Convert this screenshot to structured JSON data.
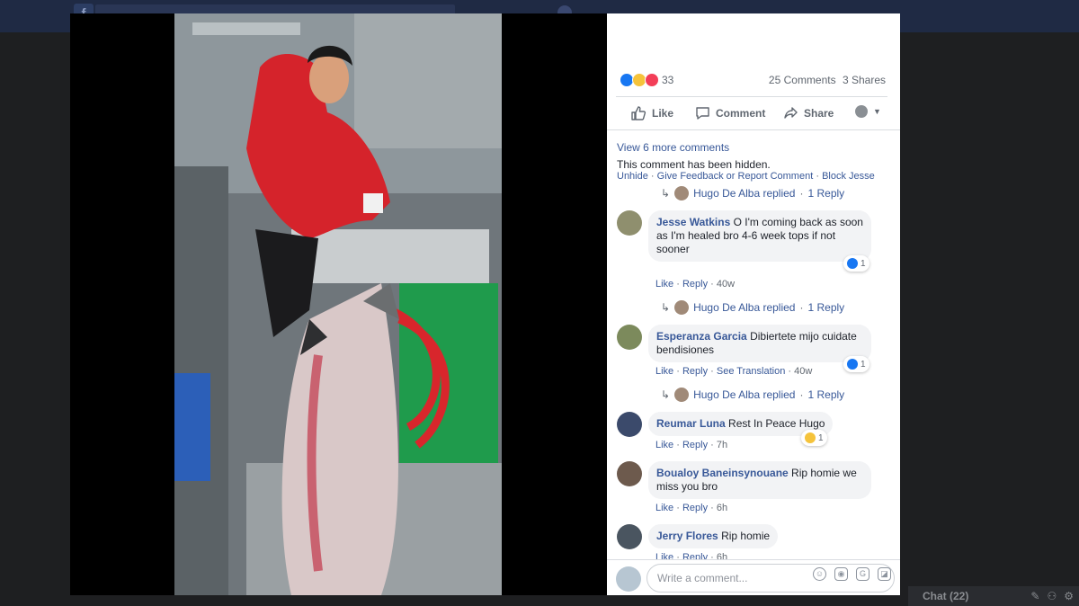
{
  "reactions": {
    "count": "33",
    "types": [
      "like",
      "wow",
      "love"
    ],
    "colors": {
      "like": "#1877f2",
      "wow": "#f5c33b",
      "love": "#f33e58"
    }
  },
  "stats": {
    "comments": "25 Comments",
    "shares": "3 Shares"
  },
  "actions": {
    "like": "Like",
    "comment": "Comment",
    "share": "Share"
  },
  "view_more": "View 6 more comments",
  "hidden": {
    "text": "This comment has been hidden.",
    "unhide": "Unhide",
    "feedback": "Give Feedback or Report Comment",
    "block": "Block Jesse"
  },
  "reply_summary": {
    "name": "Hugo De Alba replied",
    "count": "1 Reply"
  },
  "comments": [
    {
      "name": "Jesse Watkins",
      "text": "O I'm coming back as soon as I'm healed bro 4-6 week tops if not sooner",
      "like": "Like",
      "reply": "Reply",
      "time": "40w",
      "reactions": "1",
      "replies": {
        "name": "Hugo De Alba replied",
        "count": "1 Reply"
      }
    },
    {
      "name": "Esperanza Garcia",
      "text": "Dibiertete mijo cuidate bendisiones",
      "like": "Like",
      "reply": "Reply",
      "translate": "See Translation",
      "time": "40w",
      "reactions": "1",
      "replies": {
        "name": "Hugo De Alba replied",
        "count": "1 Reply"
      }
    },
    {
      "name": "Reumar Luna",
      "text": "Rest In Peace Hugo",
      "like": "Like",
      "reply": "Reply",
      "time": "7h",
      "reactions": "1"
    },
    {
      "name": "Boualoy Baneinsynouane",
      "text": "Rip homie we miss you bro",
      "like": "Like",
      "reply": "Reply",
      "time": "6h"
    },
    {
      "name": "Jerry Flores",
      "text": "Rip homie",
      "like": "Like",
      "reply": "Reply",
      "time": "6h"
    }
  ],
  "composer": {
    "placeholder": "Write a comment..."
  },
  "chat": {
    "label": "Chat (22)"
  }
}
